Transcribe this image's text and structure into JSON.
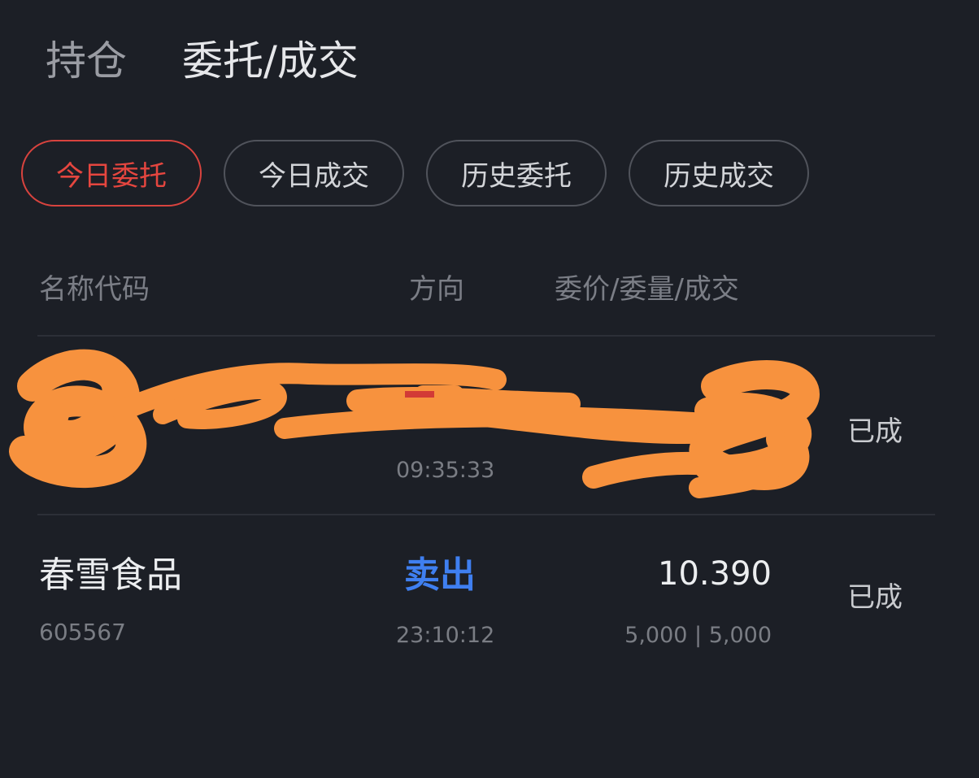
{
  "top_tabs": [
    {
      "label": "持仓"
    },
    {
      "label": "委托/成交"
    }
  ],
  "chips": [
    {
      "label": "今日委托"
    },
    {
      "label": "今日成交"
    },
    {
      "label": "历史委托"
    },
    {
      "label": "历史成交"
    }
  ],
  "columns": {
    "name_code": "名称代码",
    "direction": "方向",
    "price_qty_deal": "委价/委量/成交"
  },
  "orders": [
    {
      "name": "",
      "code": "",
      "direction": "",
      "time": "09:35:33",
      "price": "",
      "qty": "",
      "status": "已成"
    },
    {
      "name": "春雪食品",
      "code": "605567",
      "direction": "卖出",
      "time": "23:10:12",
      "price": "10.390",
      "qty": "5,000 | 5,000",
      "status": "已成"
    }
  ],
  "colors": {
    "background": "#1c1f26",
    "active_chip": "#e5463f",
    "sell_direction": "#3f7ff0",
    "redaction_scribble": "#f7923e"
  }
}
